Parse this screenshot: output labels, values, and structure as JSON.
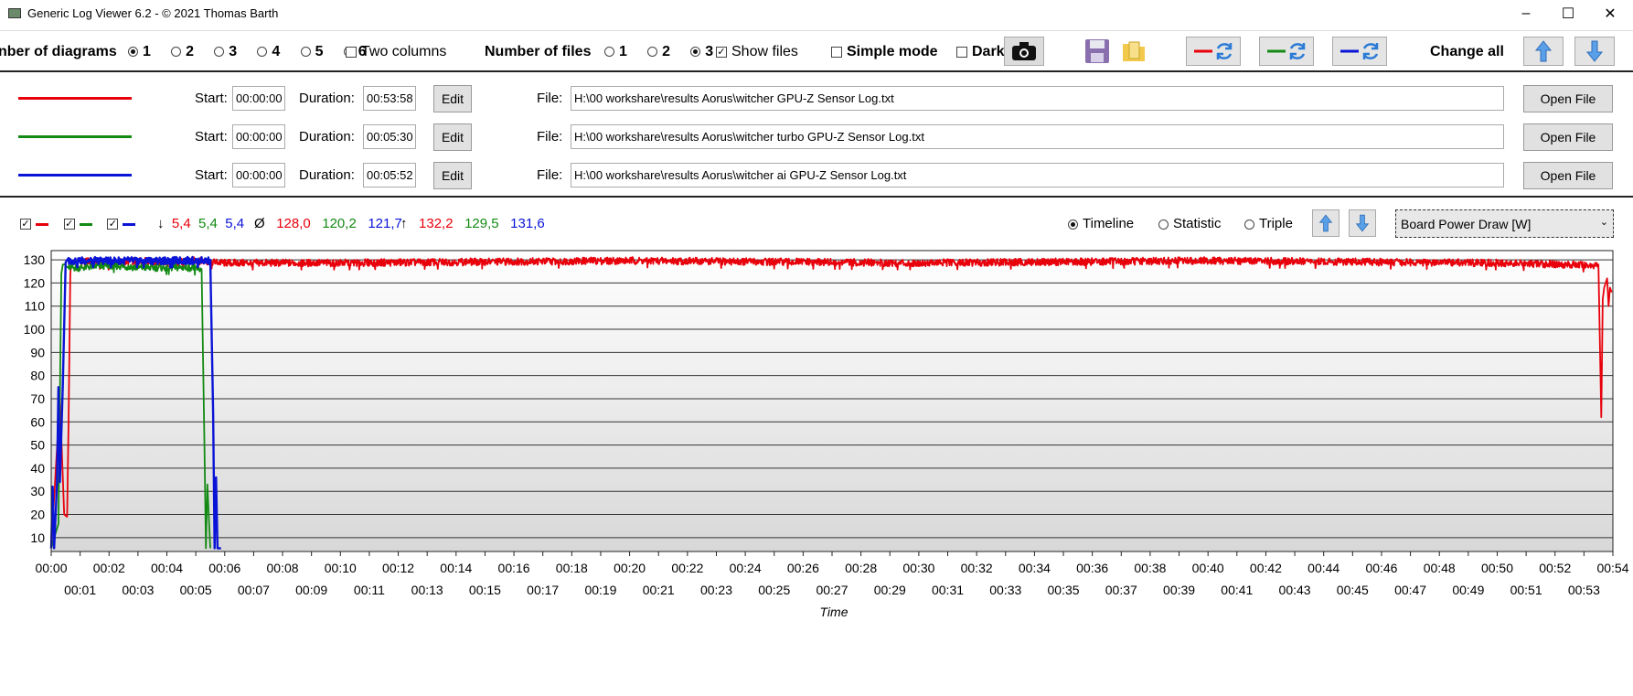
{
  "window": {
    "title": "Generic Log Viewer 6.2 - © 2021 Thomas Barth"
  },
  "toolbar": {
    "num_diagrams_label": "nber of diagrams",
    "diagram_options": [
      "1",
      "2",
      "3",
      "4",
      "5",
      "6"
    ],
    "diagram_selected": "1",
    "two_columns_label": "Two columns",
    "num_files_label": "Number of files",
    "file_options": [
      "1",
      "2",
      "3"
    ],
    "file_selected": "3",
    "show_files_label": "Show files",
    "simple_mode_label": "Simple mode",
    "dark_label": "Dark",
    "change_all_label": "Change all"
  },
  "files": [
    {
      "color": "#e8000b",
      "start_label": "Start:",
      "start": "00:00:00",
      "duration_label": "Duration:",
      "duration": "00:53:58",
      "edit_label": "Edit",
      "file_label": "File:",
      "path": "H:\\00 workshare\\results Aorus\\witcher GPU-Z Sensor Log.txt",
      "open_label": "Open File"
    },
    {
      "color": "#138a13",
      "start_label": "Start:",
      "start": "00:00:00",
      "duration_label": "Duration:",
      "duration": "00:05:30",
      "edit_label": "Edit",
      "file_label": "File:",
      "path": "H:\\00 workshare\\results Aorus\\witcher turbo GPU-Z Sensor Log.txt",
      "open_label": "Open File"
    },
    {
      "color": "#0a14d6",
      "start_label": "Start:",
      "start": "00:00:00",
      "duration_label": "Duration:",
      "duration": "00:05:52",
      "edit_label": "Edit",
      "file_label": "File:",
      "path": "H:\\00 workshare\\results Aorus\\witcher ai GPU-Z Sensor Log.txt",
      "open_label": "Open File"
    }
  ],
  "stats": {
    "min_symbol": "↓",
    "min": [
      "5,4",
      "5,4",
      "5,4"
    ],
    "avg_symbol": "Ø",
    "avg": [
      "128,0",
      "120,2",
      "121,7"
    ],
    "max_symbol": "↑",
    "max": [
      "132,2",
      "129,5",
      "131,6"
    ]
  },
  "view_modes": {
    "timeline": "Timeline",
    "statistic": "Statistic",
    "triple": "Triple",
    "selected": "Timeline"
  },
  "sensor_select": {
    "value": "Board Power Draw [W]"
  },
  "chart_data": {
    "type": "line",
    "xlabel": "Time",
    "ylabel": "",
    "x_unit": "minutes",
    "xlim": [
      0,
      54
    ],
    "ylim": [
      4,
      134
    ],
    "y_ticks": [
      10,
      20,
      30,
      40,
      50,
      60,
      70,
      80,
      90,
      100,
      110,
      120,
      130
    ],
    "x_ticks_top": [
      "00:00",
      "00:02",
      "00:04",
      "00:06",
      "00:08",
      "00:10",
      "00:12",
      "00:14",
      "00:16",
      "00:18",
      "00:20",
      "00:22",
      "00:24",
      "00:26",
      "00:28",
      "00:30",
      "00:32",
      "00:34",
      "00:36",
      "00:38",
      "00:40",
      "00:42",
      "00:44",
      "00:46",
      "00:48",
      "00:50",
      "00:52",
      "00:54"
    ],
    "x_ticks_bottom": [
      "00:01",
      "00:03",
      "00:05",
      "00:07",
      "00:09",
      "00:11",
      "00:13",
      "00:15",
      "00:17",
      "00:19",
      "00:21",
      "00:23",
      "00:25",
      "00:27",
      "00:29",
      "00:31",
      "00:33",
      "00:35",
      "00:37",
      "00:39",
      "00:41",
      "00:43",
      "00:45",
      "00:47",
      "00:49",
      "00:51",
      "00:53"
    ],
    "series": [
      {
        "color": "#e8000b",
        "x": [
          0,
          0.3,
          0.45,
          0.55,
          0.6,
          0.66,
          0.7,
          0.8,
          1.0,
          2.0,
          3.0,
          4.0,
          5.0,
          6.0,
          10,
          20,
          30,
          40,
          50,
          53.5,
          53.6,
          53.65,
          53.7,
          53.8,
          53.85,
          53.9,
          53.96
        ],
        "y": [
          5.4,
          70,
          20,
          19,
          60,
          124,
          129,
          129,
          130,
          129,
          130,
          129,
          130,
          129,
          129,
          130,
          129,
          130,
          129,
          128,
          62,
          113,
          118,
          122,
          110,
          118,
          116
        ]
      },
      {
        "color": "#138a13",
        "x": [
          0,
          0.25,
          0.35,
          0.4,
          0.5,
          1.0,
          2.0,
          3.0,
          4.0,
          4.9,
          5.2,
          5.3,
          5.35,
          5.4,
          5.5
        ],
        "y": [
          5.4,
          16,
          124,
          128,
          127,
          127,
          128,
          127,
          127,
          127,
          126,
          50,
          5.4,
          33,
          5.4
        ]
      },
      {
        "color": "#0a14d6",
        "x": [
          0,
          0.05,
          0.1,
          0.2,
          0.25,
          0.3,
          0.4,
          0.5,
          0.6,
          1.0,
          2.0,
          3.0,
          4.0,
          5.0,
          5.5,
          5.6,
          5.65,
          5.7,
          5.75,
          5.8,
          5.87
        ],
        "y": [
          5.4,
          32,
          5.4,
          33,
          75,
          34,
          76,
          129,
          130,
          130,
          130,
          130,
          130,
          130,
          130,
          64,
          5.4,
          36,
          5.4,
          5.4,
          5.4
        ]
      }
    ]
  }
}
